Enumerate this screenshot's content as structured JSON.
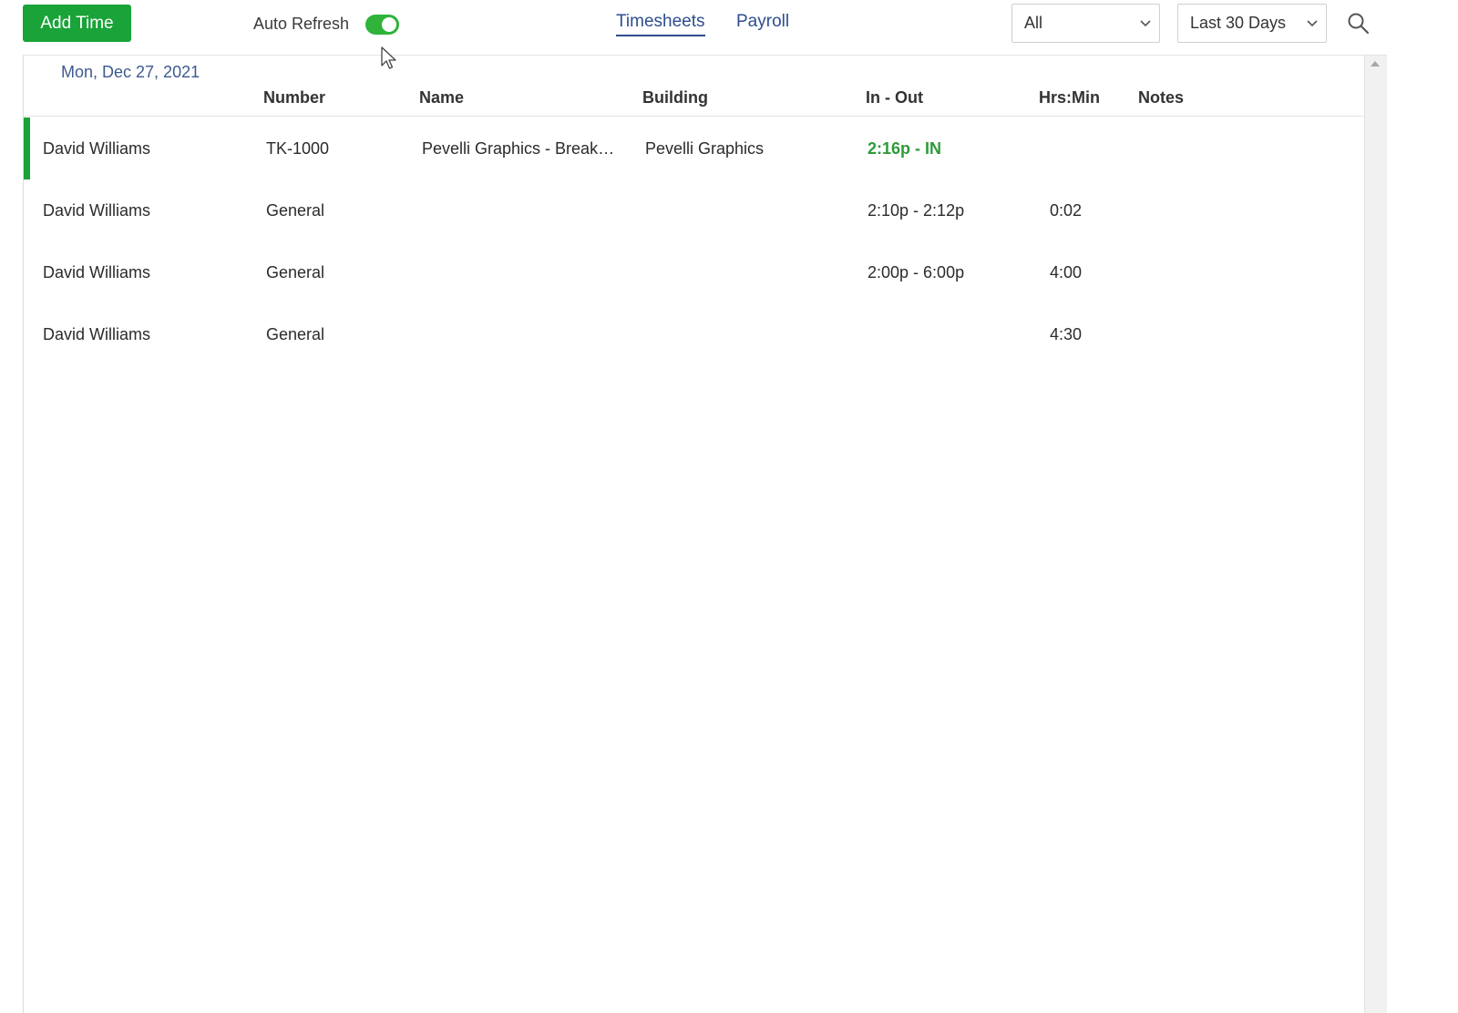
{
  "toolbar": {
    "add_time_label": "Add Time",
    "auto_refresh_label": "Auto Refresh",
    "auto_refresh_on": true,
    "tabs": [
      {
        "label": "Timesheets",
        "active": true
      },
      {
        "label": "Payroll",
        "active": false
      }
    ],
    "filter_selected": "All",
    "range_selected": "Last 30 Days",
    "search_icon": "search-icon"
  },
  "list": {
    "date_label": "Mon, Dec 27, 2021",
    "columns": [
      "Number",
      "Name",
      "Building",
      "In - Out",
      "Hrs:Min",
      "Notes"
    ],
    "rows": [
      {
        "employee": "David Williams",
        "number": "TK-1000",
        "name": "Pevelli Graphics - Break…",
        "building": "Pevelli Graphics",
        "in_out": "2:16p - IN",
        "hrs": "",
        "notes": "",
        "active": true
      },
      {
        "employee": "David Williams",
        "number": "General",
        "name": "",
        "building": "",
        "in_out": "2:10p - 2:12p",
        "hrs": "0:02",
        "notes": "",
        "active": false
      },
      {
        "employee": "David Williams",
        "number": "General",
        "name": "",
        "building": "",
        "in_out": "2:00p - 6:00p",
        "hrs": "4:00",
        "notes": "",
        "active": false
      },
      {
        "employee": "David Williams",
        "number": "General",
        "name": "",
        "building": "",
        "in_out": "",
        "hrs": "4:30",
        "notes": "",
        "active": false
      }
    ]
  },
  "colors": {
    "accent_green": "#1aa338",
    "link_blue": "#2e4d8f",
    "status_green": "#2e9a3a"
  }
}
